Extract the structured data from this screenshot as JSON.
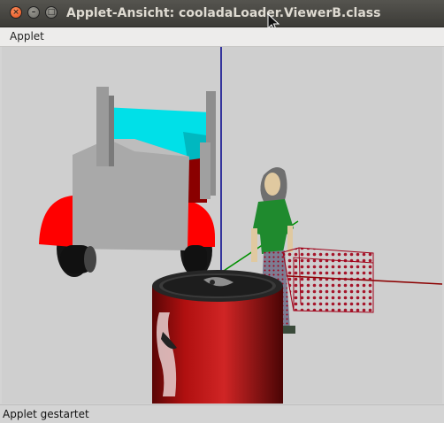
{
  "window": {
    "title": "Applet-Ansicht: cooladaLoader.ViewerB.class",
    "close_icon": "close-icon",
    "minimize_icon": "minimize-icon",
    "maximize_icon": "maximize-icon"
  },
  "menu": {
    "items": [
      {
        "label": "Applet"
      }
    ]
  },
  "scene": {
    "objects": [
      "truck-model",
      "person-model",
      "cola-can-model",
      "wireframe-crate-model",
      "coordinate-axes"
    ],
    "colors": {
      "background": "#cfcfcf",
      "truck_cab": "#00e0e8",
      "truck_body": "#a7a7a7",
      "truck_fender": "#ff0000",
      "person_shirt": "#1f8a2e",
      "can": "#b01010",
      "crate": "#a00018",
      "axis_x": "#8b0000",
      "axis_y": "#00008b",
      "axis_z": "#009000"
    }
  },
  "status": {
    "text": "Applet gestartet"
  }
}
